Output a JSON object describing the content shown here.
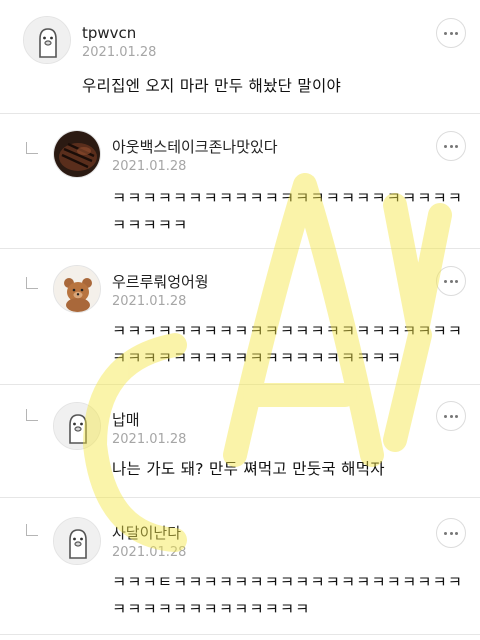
{
  "comments": [
    {
      "username": "tpwvcn",
      "date": "2021.01.28",
      "text_lines": [
        "우리집엔 오지 마라 만두 해놨단 말이야"
      ],
      "avatar": "default-penguin-avatar"
    },
    {
      "username": "아웃백스테이크존나맛있다",
      "date": "2021.01.28",
      "text_lines": [
        "ㅋㅋㅋㅋㅋㅋㅋㅋㅋㅋㅋㅋㅋㅋㅋㅋㅋㅋㅋㅋㅋㅋㅋ",
        "ㅋㅋㅋㅋㅋ"
      ],
      "avatar": "steak-photo-avatar"
    },
    {
      "username": "우르루뤄엉어웡",
      "date": "2021.01.28",
      "text_lines": [
        "ㅋㅋㅋㅋㅋㅋㅋㅋㅋㅋㅋㅋㅋㅋㅋㅋㅋㅋㅋㅋㅋㅋㅋ",
        "ㅋㅋㅋㅋㅋㅋㅋㅋㅋㅋㅋㅋㅋㅋㅋㅋㅋㅋㅋ"
      ],
      "avatar": "teddy-bear-avatar"
    },
    {
      "username": "납매",
      "date": "2021.01.28",
      "text_lines": [
        "나는 가도 돼? 만두 쪄먹고 만둣국 해먹자"
      ],
      "avatar": "default-penguin-avatar"
    },
    {
      "username": "사달이난다",
      "date": "2021.01.28",
      "text_lines": [
        "ㅋㅋㅋㅌㅋㅋㅋㅋㅋㅋㅋㅋㅋㅋㅋㅋㅋㅋㅋㅋㅋㅋㅋ",
        "ㅋㅋㅋㅋㅋㅋㅋㅋㅋㅋㅋㅋㅋ"
      ],
      "avatar": "default-penguin-avatar"
    }
  ],
  "watermark": {
    "text": "",
    "color": "#f5e642"
  },
  "colors": {
    "date": "#a6a6a6",
    "divider": "#e6e6e6",
    "reply_mark": "#b5b5b5"
  }
}
